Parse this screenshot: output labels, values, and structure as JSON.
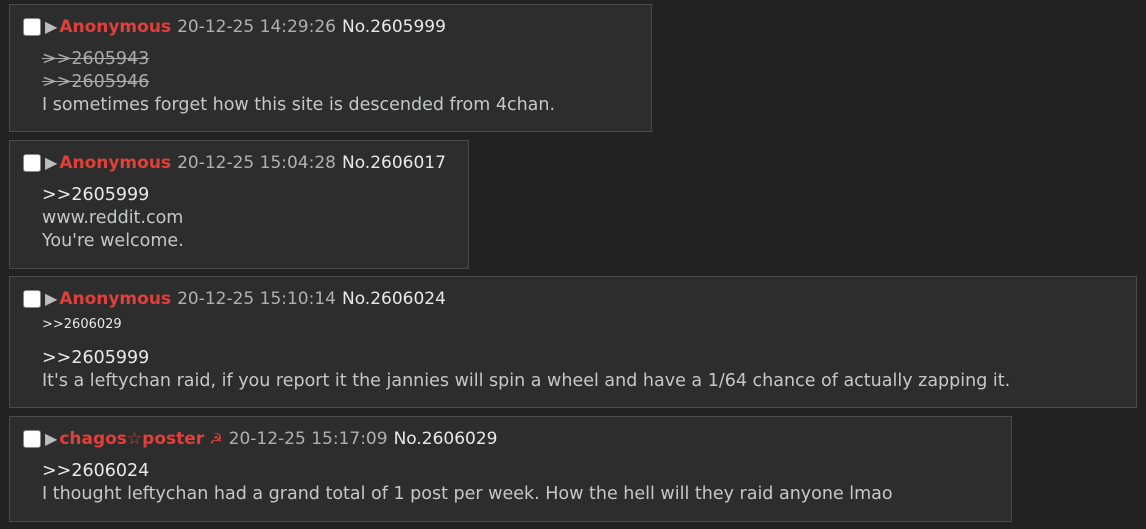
{
  "posts": [
    {
      "name": "Anonymous",
      "date": "20-12-25 14:29:26",
      "number": "No.2605999",
      "lines": [
        {
          "text": ">>2605943",
          "kind": "dead"
        },
        {
          "text": ">>2605946",
          "kind": "dead"
        },
        {
          "text": "I sometimes forget how this site is descended from 4chan.",
          "kind": "text"
        }
      ]
    },
    {
      "name": "Anonymous",
      "date": "20-12-25 15:04:28",
      "number": "No.2606017",
      "lines": [
        {
          "text": ">>2605999",
          "kind": "quote"
        },
        {
          "text": "www.reddit.com",
          "kind": "text"
        },
        {
          "text": "You're welcome.",
          "kind": "text"
        }
      ]
    },
    {
      "name": "Anonymous",
      "date": "20-12-25 15:10:14",
      "number": "No.2606024",
      "backlink": ">>2606029",
      "lines": [
        {
          "text": ">>2605999",
          "kind": "quote"
        },
        {
          "text": "It's a leftychan raid, if you report it the jannies will spin a wheel and have a 1/64 chance of actually zapping it.",
          "kind": "text"
        }
      ]
    },
    {
      "name": "chagos☆poster",
      "flag": "☭",
      "date": "20-12-25 15:17:09",
      "number": "No.2606029",
      "lines": [
        {
          "text": ">>2606024",
          "kind": "quote"
        },
        {
          "text": "I thought leftychan had a grand total of 1 post per week. How the hell will they raid anyone lmao",
          "kind": "text"
        }
      ]
    }
  ],
  "icons": {
    "select": "checkbox",
    "expand": "play-arrow-icon",
    "flag": "hammer-sickle-icon"
  },
  "colors": {
    "background": "#222222",
    "post_bg": "#2d2d2d",
    "name": "#e0403a",
    "text": "#c5c8c6"
  }
}
